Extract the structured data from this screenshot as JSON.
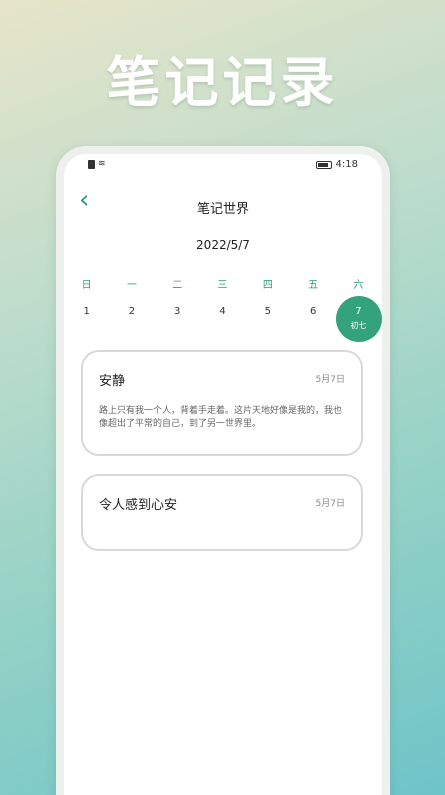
{
  "hero": {
    "title": "笔记记录"
  },
  "status": {
    "time": "4:18"
  },
  "nav": {
    "title": "笔记世界"
  },
  "calendar": {
    "date": "2022/5/7",
    "weekdays": [
      "日",
      "一",
      "二",
      "三",
      "四",
      "五",
      "六"
    ],
    "days": [
      "1",
      "2",
      "3",
      "4",
      "5",
      "6",
      "7"
    ],
    "selected_day": "7",
    "selected_lunar": "初七"
  },
  "notes": [
    {
      "title": "安静",
      "date": "5月7日",
      "body": "路上只有我一个人，背着手走着。这片天地好像是我的，我也像超出了平常的自己，到了另一世界里。"
    },
    {
      "title": "令人感到心安",
      "date": "5月7日",
      "body": ""
    }
  ],
  "colors": {
    "accent": "#35a27e"
  }
}
